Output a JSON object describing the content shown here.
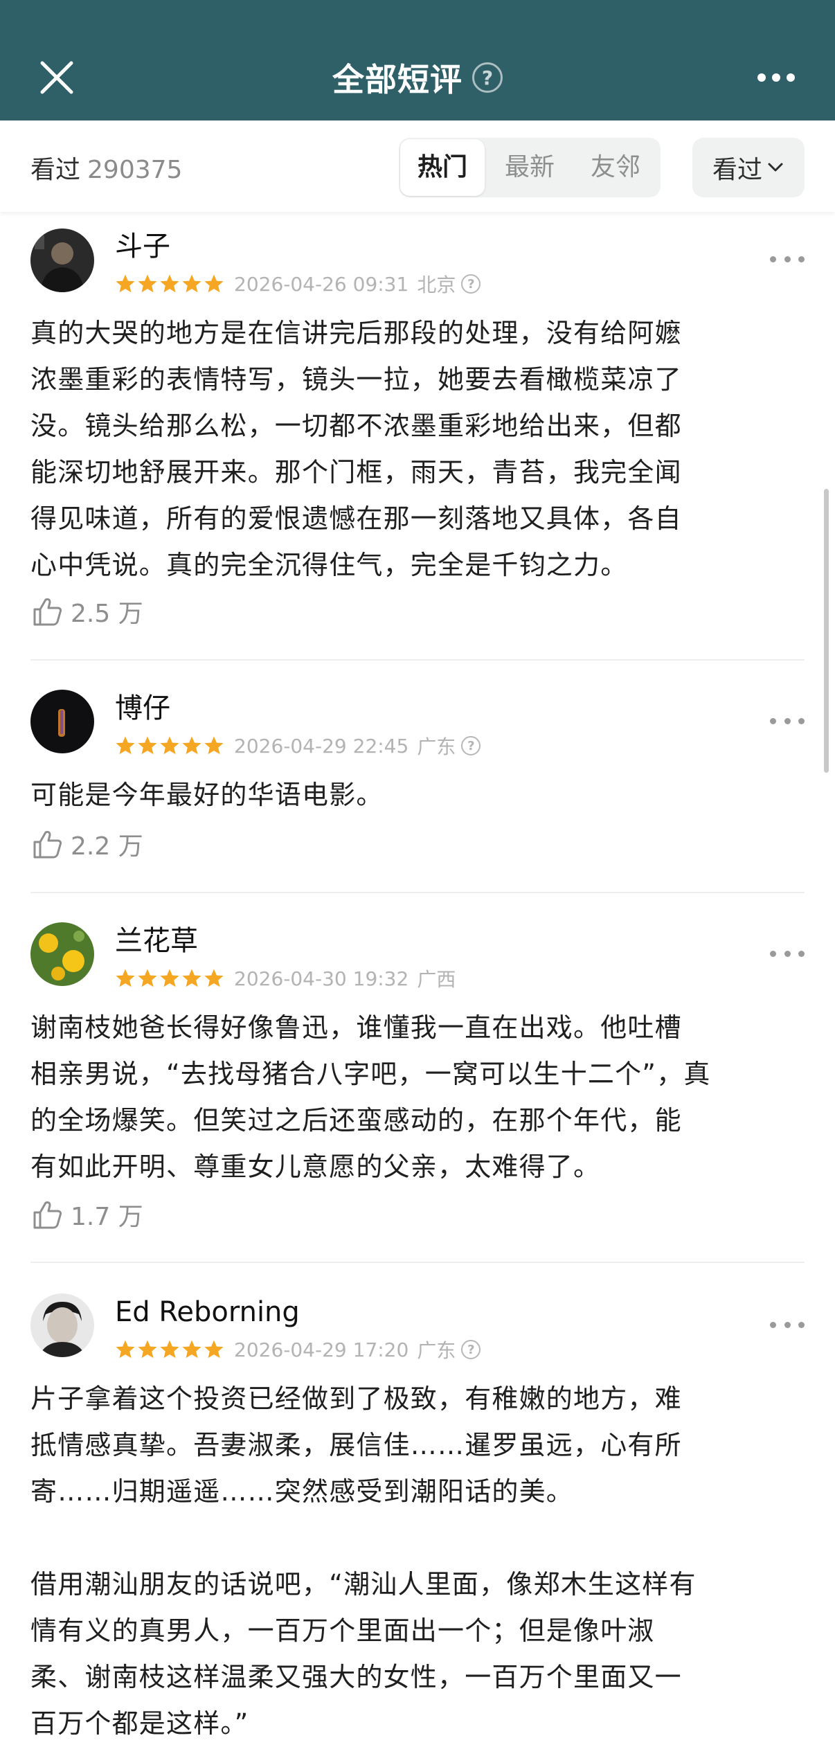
{
  "header": {
    "title": "全部短评",
    "close_icon": "close-icon",
    "help_icon": "help-icon",
    "more_icon": "more-icon",
    "background_color": "#2f5f67"
  },
  "filter_bar": {
    "watched_label": "看过",
    "watched_count": "290375",
    "tabs": [
      {
        "label": "热门",
        "active": true
      },
      {
        "label": "最新",
        "active": false
      },
      {
        "label": "友邻",
        "active": false
      }
    ],
    "status_dropdown": {
      "label": "看过",
      "icon": "chevron-down-icon"
    }
  },
  "star_color": "#f5a623",
  "comments": [
    {
      "username": "斗子",
      "rating": 5,
      "date": "2026-04-26 09:31",
      "location": "北京",
      "has_info_icon": true,
      "text": "真的大哭的地方是在信讲完后那段的处理，没有给阿嬷\n浓墨重彩的表情特写，镜头一拉，她要去看橄榄菜凉了\n没。镜头给那么松，一切都不浓墨重彩地给出来，但都\n能深切地舒展开来。那个门框，雨天，青苔，我完全闻\n得见味道，所有的爱恨遗憾在那一刻落地又具体，各自\n心中凭说。真的完全沉得住气，完全是千钧之力。",
      "likes": "2.5 万"
    },
    {
      "username": "博仔",
      "rating": 5,
      "date": "2026-04-29 22:45",
      "location": "广东",
      "has_info_icon": true,
      "text": "可能是今年最好的华语电影。",
      "likes": "2.2 万"
    },
    {
      "username": "兰花草",
      "rating": 5,
      "date": "2026-04-30 19:32",
      "location": "广西",
      "has_info_icon": false,
      "text": "谢南枝她爸长得好像鲁迅，谁懂我一直在出戏。他吐槽\n相亲男说，“去找母猪合八字吧，一窝可以生十二个”，真\n的全场爆笑。但笑过之后还蛮感动的，在那个年代，能\n有如此开明、尊重女儿意愿的父亲，太难得了。",
      "likes": "1.7 万"
    },
    {
      "username": "Ed Reborning",
      "rating": 5,
      "date": "2026-04-29 17:20",
      "location": "广东",
      "has_info_icon": true,
      "text": "片子拿着这个投资已经做到了极致，有稚嫩的地方，难\n抵情感真挚。吾妻淑柔，展信佳……暹罗虽远，心有所\n寄……归期遥遥……突然感受到潮阳话的美。\n\n借用潮汕朋友的话说吧，“潮汕人里面，像郑木生这样有\n情有义的真男人，一百万个里面出一个；但是像叶淑\n柔、谢南枝这样温柔又强大的女性，一百万个里面又一\n百万个都是这样。”",
      "likes": ""
    }
  ]
}
